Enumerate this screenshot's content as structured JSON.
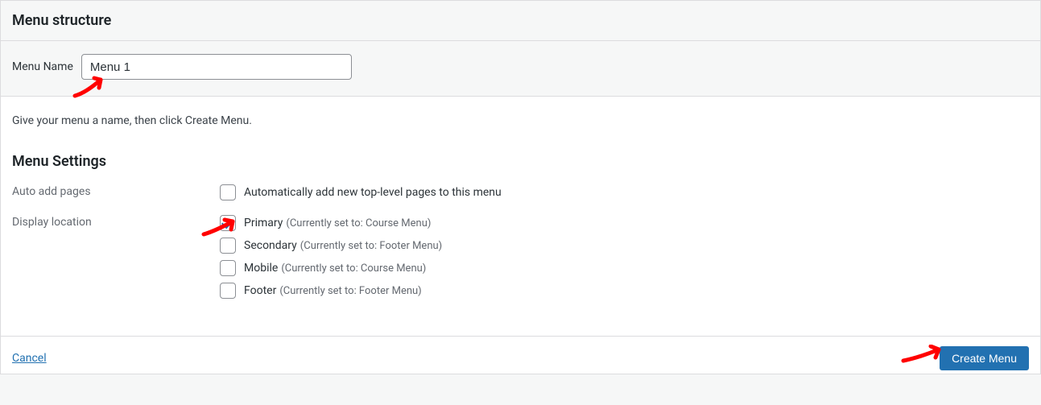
{
  "section_title": "Menu structure",
  "menu_name": {
    "label": "Menu Name",
    "value": "Menu 1"
  },
  "instruction_text": "Give your menu a name, then click Create Menu.",
  "settings": {
    "heading": "Menu Settings",
    "auto_add": {
      "label": "Auto add pages",
      "checkbox_text": "Automatically add new top-level pages to this menu",
      "checked": false
    },
    "display_location": {
      "label": "Display location",
      "options": [
        {
          "name": "Primary",
          "sub": "(Currently set to: Course Menu)",
          "checked": true
        },
        {
          "name": "Secondary",
          "sub": "(Currently set to: Footer Menu)",
          "checked": false
        },
        {
          "name": "Mobile",
          "sub": "(Currently set to: Course Menu)",
          "checked": false
        },
        {
          "name": "Footer",
          "sub": "(Currently set to: Footer Menu)",
          "checked": false
        }
      ]
    }
  },
  "footer": {
    "cancel": "Cancel",
    "create": "Create Menu"
  }
}
